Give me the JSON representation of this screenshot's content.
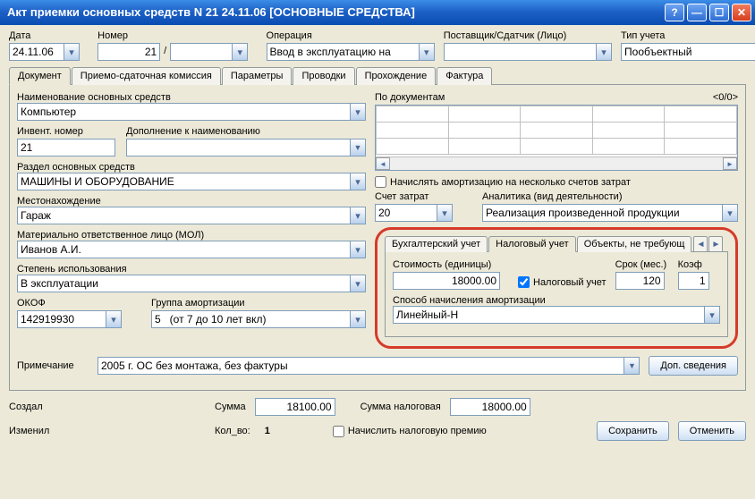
{
  "window": {
    "title": "Акт приемки основных средств N 21 24.11.06 [ОСНОВНЫЕ СРЕДСТВА]"
  },
  "header": {
    "date_label": "Дата",
    "date_value": "24.11.06",
    "number_label": "Номер",
    "number_value": "21",
    "number_sep": "/",
    "number2_value": "",
    "operation_label": "Операция",
    "operation_value": "Ввод в эксплуатацию на",
    "supplier_label": "Поставщик/Сдатчик (Лицо)",
    "supplier_value": "",
    "account_type_label": "Тип учета",
    "account_type_value": "Пообъектный"
  },
  "main_tabs": [
    "Документ",
    "Приемо-сдаточная комиссия",
    "Параметры",
    "Проводки",
    "Прохождение",
    "Фактура"
  ],
  "doc": {
    "name_label": "Наименование основных средств",
    "name_value": "Компьютер",
    "inv_label": "Инвент. номер",
    "inv_value": "21",
    "addname_label": "Дополнение к наименованию",
    "addname_value": "",
    "section_label": "Раздел основных средств",
    "section_value": "МАШИНЫ И ОБОРУДОВАНИЕ",
    "location_label": "Местонахождение",
    "location_value": "Гараж",
    "mol_label": "Материально ответственное лицо (МОЛ)",
    "mol_value": "Иванов А.И.",
    "usage_label": "Степень использования",
    "usage_value": "В эксплуатации",
    "okof_label": "ОКОФ",
    "okof_value": "142919930",
    "amort_group_label": "Группа амортизации",
    "amort_group_value": "5   (от 7 до 10 лет вкл)"
  },
  "right": {
    "bydoc_label": "По документам",
    "pager": "<0/0>",
    "amort_multi_label": "Начислять амортизацию на несколько счетов затрат",
    "cost_acct_label": "Счет затрат",
    "cost_acct_value": "20",
    "analytics_label": "Аналитика (вид деятельности)",
    "analytics_value": "Реализация произведенной продукции"
  },
  "sub_tabs": [
    "Бухгалтерский учет",
    "Налоговый учет",
    "Объекты, не требующ"
  ],
  "tax": {
    "cost_label": "Стоимость (единицы)",
    "cost_value": "18000.00",
    "tax_chk_label": "Налоговый учет",
    "term_label": "Срок (мес.)",
    "term_value": "120",
    "koef_label": "Коэф",
    "koef_value": "1",
    "method_label": "Способ начисления амортизации",
    "method_value": "Линейный-Н"
  },
  "bottom": {
    "note_label": "Примечание",
    "note_value": "2005 г. ОС без монтажа, без фактуры",
    "extra_btn": "Доп. сведения"
  },
  "footer": {
    "created_label": "Создал",
    "modified_label": "Изменил",
    "sum_label": "Сумма",
    "sum_value": "18100.00",
    "sum_tax_label": "Сумма налоговая",
    "sum_tax_value": "18000.00",
    "qty_label": "Кол_во:",
    "qty_value": "1",
    "premium_label": "Начислить налоговую премию",
    "save_btn": "Сохранить",
    "cancel_btn": "Отменить"
  }
}
